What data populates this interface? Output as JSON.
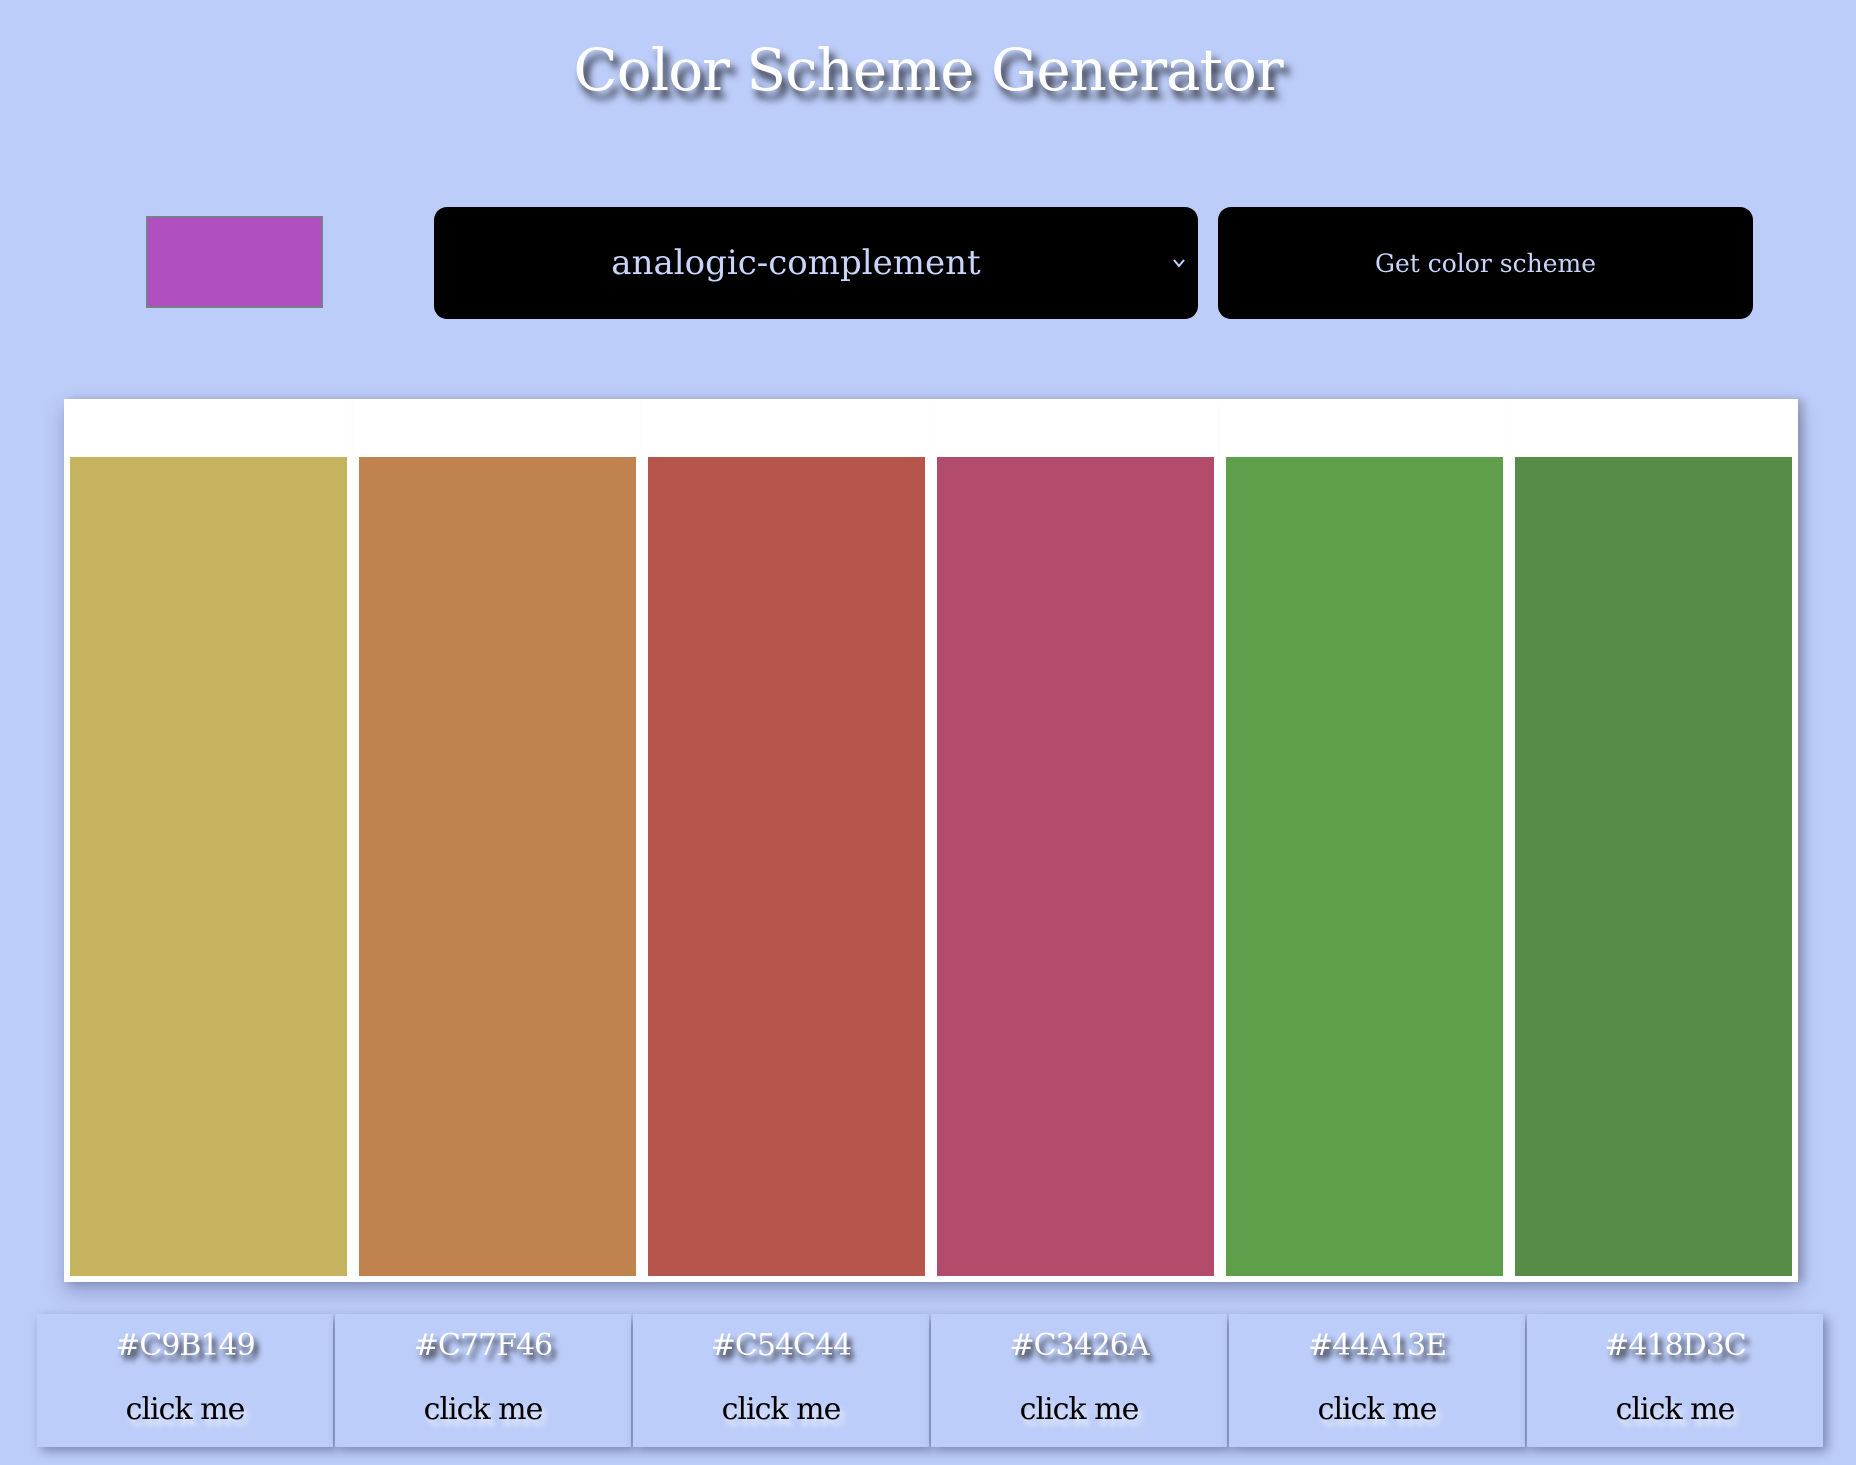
{
  "header": {
    "title": "Color Scheme Generator"
  },
  "controls": {
    "seed_color": "#B04FC0",
    "mode_value": "analogic-complement",
    "get_button_label": "Get color scheme"
  },
  "colors": [
    {
      "hex": "#C9B149",
      "swatch": "#C6B35F",
      "action_label": "click me"
    },
    {
      "hex": "#C77F46",
      "swatch": "#C08350",
      "action_label": "click me"
    },
    {
      "hex": "#C54C44",
      "swatch": "#B5554B",
      "action_label": "click me"
    },
    {
      "hex": "#C3426A",
      "swatch": "#B34B6A",
      "action_label": "click me"
    },
    {
      "hex": "#44A13E",
      "swatch": "#5F9F4B",
      "action_label": "click me"
    },
    {
      "hex": "#418D3C",
      "swatch": "#578B48",
      "action_label": "click me"
    }
  ]
}
